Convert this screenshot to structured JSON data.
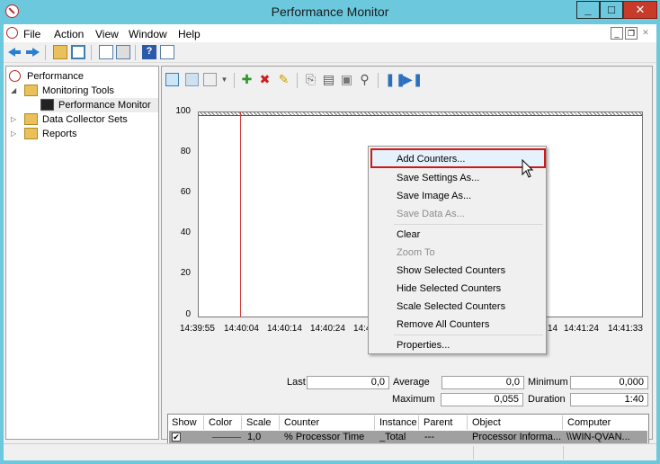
{
  "window": {
    "title": "Performance Monitor"
  },
  "menubar": {
    "file": "File",
    "action": "Action",
    "view": "View",
    "window": "Window",
    "help": "Help"
  },
  "tree": {
    "root": "Performance",
    "monitoring_tools": "Monitoring Tools",
    "performance_monitor": "Performance Monitor",
    "data_collector_sets": "Data Collector Sets",
    "reports": "Reports"
  },
  "graph": {
    "y_ticks": [
      "100",
      "80",
      "60",
      "40",
      "20",
      "0"
    ],
    "x_ticks": [
      "14:39:55",
      "14:40:04",
      "14:40:14",
      "14:40:24",
      "14:4",
      "14",
      "14:41:24",
      "14:41:33"
    ]
  },
  "stats": {
    "last_label": "Last",
    "last_value": "0,0",
    "average_label": "Average",
    "average_value": "0,0",
    "minimum_label": "Minimum",
    "minimum_value": "0,000",
    "maximum_label": "Maximum",
    "maximum_value": "0,055",
    "duration_label": "Duration",
    "duration_value": "1:40"
  },
  "counter_table": {
    "headers": [
      "Show",
      "Color",
      "Scale",
      "Counter",
      "Instance",
      "Parent",
      "Object",
      "Computer"
    ],
    "rows": [
      {
        "show": "✔",
        "scale": "1,0",
        "counter": "% Processor Time",
        "instance": "_Total",
        "parent": "---",
        "object": "Processor Informa...",
        "computer": "\\\\WIN-QVAN..."
      }
    ]
  },
  "context_menu": {
    "items": [
      {
        "label": "Add Counters...",
        "disabled": false
      },
      {
        "label": "Save Settings As...",
        "disabled": false
      },
      {
        "label": "Save Image As...",
        "disabled": false
      },
      {
        "label": "Save Data As...",
        "disabled": true
      },
      {
        "label": "Clear",
        "disabled": false
      },
      {
        "label": "Zoom To",
        "disabled": true
      },
      {
        "label": "Show Selected Counters",
        "disabled": false
      },
      {
        "label": "Hide Selected Counters",
        "disabled": false
      },
      {
        "label": "Scale Selected Counters",
        "disabled": false
      },
      {
        "label": "Remove All Counters",
        "disabled": false
      },
      {
        "label": "Properties...",
        "disabled": false
      }
    ]
  },
  "colors": {
    "titlebar": "#6cc8dd",
    "close": "#c83a2a",
    "series": "#cc2020",
    "highlight_border": "#d01818"
  }
}
